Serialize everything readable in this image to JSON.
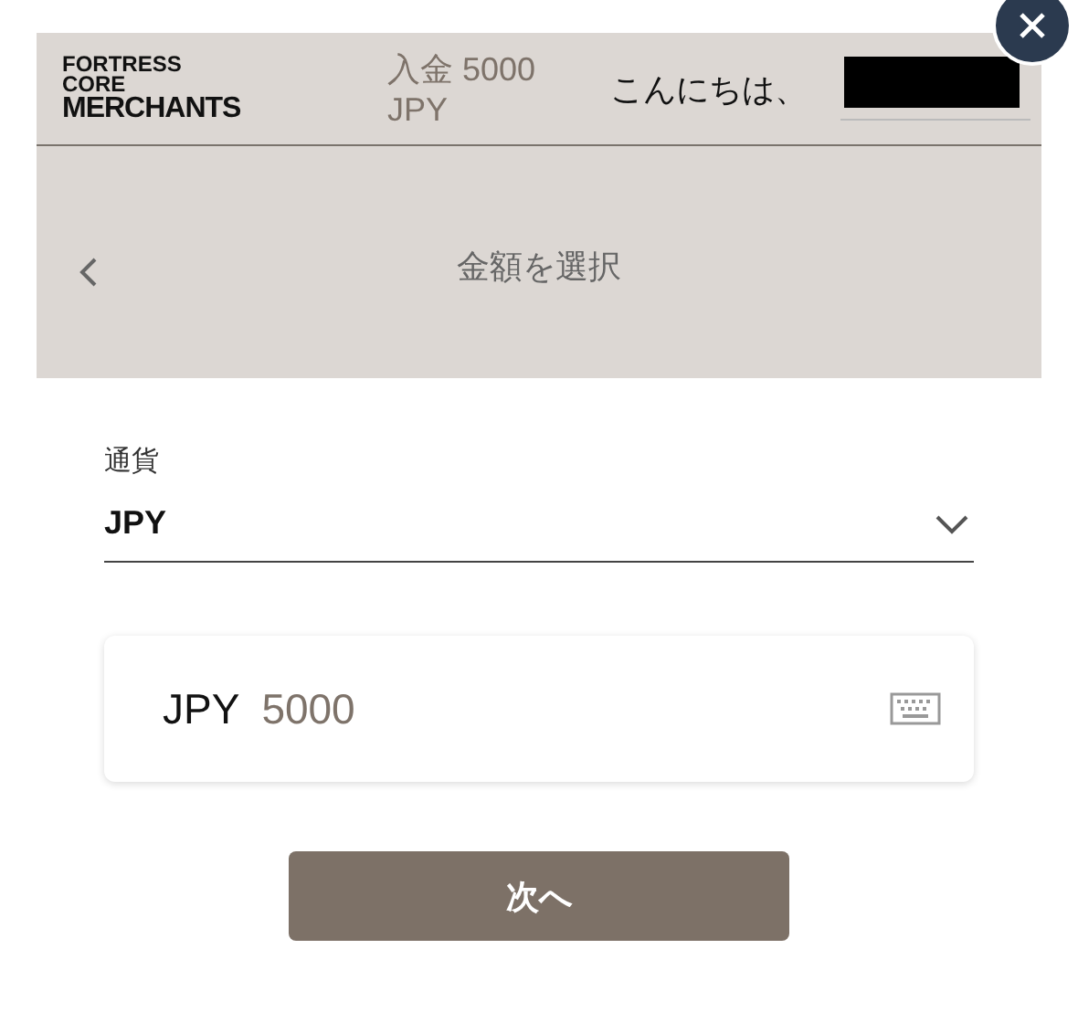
{
  "header": {
    "logo_lines": [
      "FORTRESS",
      "CORE",
      "MERCHANTS"
    ],
    "deposit": "入金 5000 JPY",
    "greeting": "こんにちは、"
  },
  "subheader": {
    "title": "金額を選択"
  },
  "currency": {
    "label": "通貨",
    "value": "JPY"
  },
  "amount": {
    "currency": "JPY",
    "value": "5000"
  },
  "next_button": "次へ"
}
